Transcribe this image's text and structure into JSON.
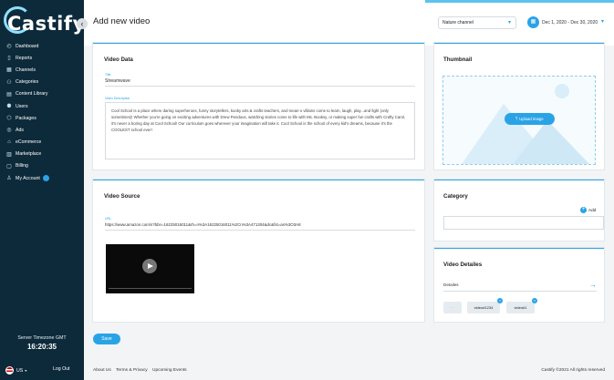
{
  "sidebar": {
    "logo": "Castify",
    "items": [
      {
        "label": "Dashboard",
        "icon": "dashboard-icon",
        "glyph": "◴"
      },
      {
        "label": "Reports",
        "icon": "bar-chart-icon",
        "glyph": "▯"
      },
      {
        "label": "Channels",
        "icon": "grid-icon",
        "glyph": "▦"
      },
      {
        "label": "Categories",
        "icon": "people-icon",
        "glyph": "⚇"
      },
      {
        "label": "Content Library",
        "icon": "library-icon",
        "glyph": "▤"
      },
      {
        "label": "Users",
        "icon": "users-icon",
        "glyph": "⚉"
      },
      {
        "label": "Packages",
        "icon": "package-icon",
        "glyph": "⬡"
      },
      {
        "label": "Ads",
        "icon": "ads-icon",
        "glyph": "◎"
      },
      {
        "label": "eCommerce",
        "icon": "bag-icon",
        "glyph": "⌂"
      },
      {
        "label": "Marketplace",
        "icon": "store-icon",
        "glyph": "▥"
      },
      {
        "label": "Billing",
        "icon": "billing-icon",
        "glyph": "▢"
      },
      {
        "label": "My Account",
        "icon": "user-icon",
        "glyph": "♙"
      }
    ],
    "timezone_label": "Server Timezone GMT",
    "timezone_time": "16:20:35",
    "language": "US",
    "logout": "Log Out"
  },
  "header": {
    "title": "Add new video",
    "channel": "Nature channel",
    "date_range": "Dec 1, 2020 - Dec 30, 2020"
  },
  "video_data": {
    "title": "Video Data",
    "title_label": "Title",
    "title_value": "Streamwave",
    "description_label": "Video Description",
    "description": "Cool School is a place where daring superheroes, funny storytellers, kooky arts & crafts teachers, and mean-o villains come to learn, laugh, play...and fight (only sometimes)! Whether you're going on exciting adventures with Drew Pendous, watching stories come to life with Ms. Booksy, or making super fun crafts with Crafty Carol, it's never a boring day at Cool School! Our curriculum goes wherever your imagination will take it. Cool School is the school of every kid's dreams, because it's the COOLEST school ever!"
  },
  "thumbnail": {
    "title": "Thumbnail",
    "upload_label": "Upload image"
  },
  "video_source": {
    "title": "Video Source",
    "url_label": "URL",
    "url": "https://www.amazon.com/s?bbn=16225016011&rh=n%3A16225016011%2Cn%3A471304&dc&fst=as%3O3A8"
  },
  "category": {
    "title": "Category",
    "add_label": "Add"
  },
  "video_details": {
    "title": "Video Detailes",
    "details_label": "Detailes",
    "chips": [
      "video#1234",
      "video#1"
    ]
  },
  "actions": {
    "save": "Save"
  },
  "footer": {
    "links": [
      "About Us",
      "Terms & Privacy",
      "Upcoming Events"
    ],
    "copyright": "Castify ©2021 All rights reserved"
  },
  "colors": {
    "sidebar_bg": "#0d2a3b",
    "accent": "#2aa3e6"
  }
}
